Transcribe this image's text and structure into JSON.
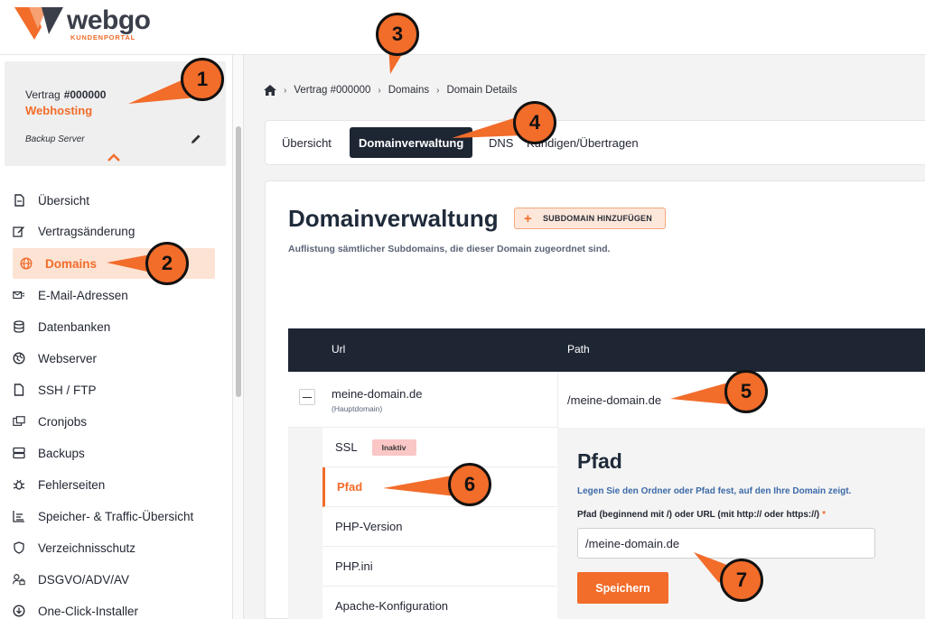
{
  "brand": {
    "name": "webgo",
    "subtitle": "KUNDENPORTAL",
    "accent": "#f26c2a",
    "dark": "#1e2634"
  },
  "contract": {
    "label": "Vertrag",
    "number": "#000000",
    "type": "Webhosting",
    "server": "Backup Server",
    "edit_icon": "pencil-icon",
    "toggle_icon": "chevron-up-icon"
  },
  "nav": {
    "items": [
      {
        "label": "Übersicht",
        "icon": "document-icon"
      },
      {
        "label": "Vertragsänderung",
        "icon": "edit-icon"
      },
      {
        "label": "Domains",
        "icon": "globe-icon",
        "active": true
      },
      {
        "label": "E-Mail-Adressen",
        "icon": "mail-icon"
      },
      {
        "label": "Datenbanken",
        "icon": "database-icon"
      },
      {
        "label": "Webserver",
        "icon": "web-globe-icon"
      },
      {
        "label": "SSH / FTP",
        "icon": "file-icon"
      },
      {
        "label": "Cronjobs",
        "icon": "cron-icon"
      },
      {
        "label": "Backups",
        "icon": "server-icon"
      },
      {
        "label": "Fehlerseiten",
        "icon": "bug-icon"
      },
      {
        "label": "Speicher- & Traffic-Übersicht",
        "icon": "chart-icon"
      },
      {
        "label": "Verzeichnisschutz",
        "icon": "shield-icon"
      },
      {
        "label": "DSGVO/ADV/AV",
        "icon": "user-lock-icon"
      },
      {
        "label": "One-Click-Installer",
        "icon": "download-icon"
      }
    ]
  },
  "breadcrumb": {
    "home_icon": "home-icon",
    "items": [
      "Vertrag #000000",
      "Domains",
      "Domain Details"
    ]
  },
  "tabs": [
    {
      "label": "Übersicht"
    },
    {
      "label": "Domainverwaltung",
      "active": true
    },
    {
      "label": "DNS"
    },
    {
      "label": "Kündigen/Übertragen"
    }
  ],
  "panel": {
    "title": "Domainverwaltung",
    "add_button": "SUBDOMAIN HINZUFÜGEN",
    "description": "Auflistung sämtlicher Subdomains, die dieser Domain zugeordnet sind."
  },
  "table": {
    "columns": [
      "Url",
      "Path"
    ],
    "rows": [
      {
        "url": "meine-domain.de",
        "url_sub": "(Hauptdomain)",
        "path": "/meine-domain.de"
      }
    ]
  },
  "detail": {
    "menu": [
      {
        "label": "SSL",
        "badge": "Inaktiv"
      },
      {
        "label": "Pfad",
        "active": true
      },
      {
        "label": "PHP-Version"
      },
      {
        "label": "PHP.ini"
      },
      {
        "label": "Apache-Konfiguration"
      }
    ],
    "form": {
      "title": "Pfad",
      "description": "Legen Sie den Ordner oder Pfad fest, auf den Ihre Domain zeigt.",
      "label": "Pfad (beginnend mit /) oder URL (mit http:// oder https://)",
      "required_mark": "*",
      "value": "/meine-domain.de",
      "save_label": "Speichern"
    }
  },
  "callouts": [
    "1",
    "2",
    "3",
    "4",
    "5",
    "6",
    "7"
  ]
}
